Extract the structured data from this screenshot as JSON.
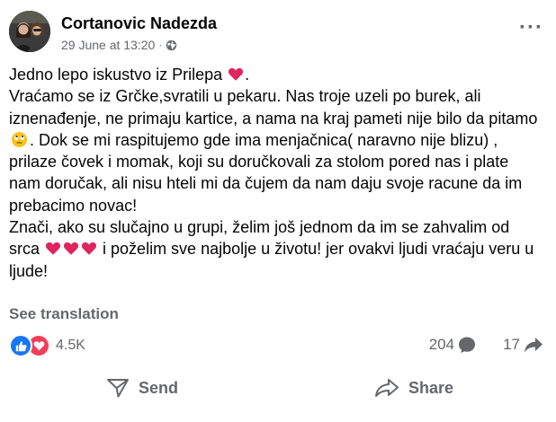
{
  "post": {
    "author": "Cortanovic Nadezda",
    "timestamp": "29 June at 13:20",
    "separator": "·",
    "privacy_icon": "globe-icon",
    "more_icon": "more-options-icon",
    "lines": {
      "l1": "Jedno lepo iskustvo iz Prilepa",
      "l2a": "Vraćamo se iz Grčke,svratili u pekaru. Nas troje uzeli po burek,  ali iznenađenje, ne primaju kartice, a nama na kraj pameti nije bilo da pitamo",
      "l2b": ". Dok se mi raspitujemo gde ima menjačnica( naravno nije blizu) , prilaze čovek i momak, koji su doručkovali za stolom pored nas i plate nam doručak, ali nisu hteli mi da čujem da nam daju svoje racune da im  prebacimo novac!",
      "l3a": "Znači, ako su slučajno u grupi, želim još jednom da im se  zahvalim od srca",
      "l3b": " i poželim sve najbolje u životu!  jer ovakvi ljudi vraćaju veru u ljude!"
    },
    "emoji": {
      "heart": "red-heart",
      "face": "rolling-eyes-face"
    },
    "see_translation": "See translation"
  },
  "stats": {
    "reactions": [
      "like",
      "love"
    ],
    "reaction_count": "4.5K",
    "comments": "204",
    "shares": "17"
  },
  "actions": {
    "send": "Send",
    "share": "Share"
  },
  "colors": {
    "text": "#050505",
    "secondary": "#65676b",
    "like": "#1877f2",
    "love": "#f33e58",
    "heart": "#e0245e"
  }
}
